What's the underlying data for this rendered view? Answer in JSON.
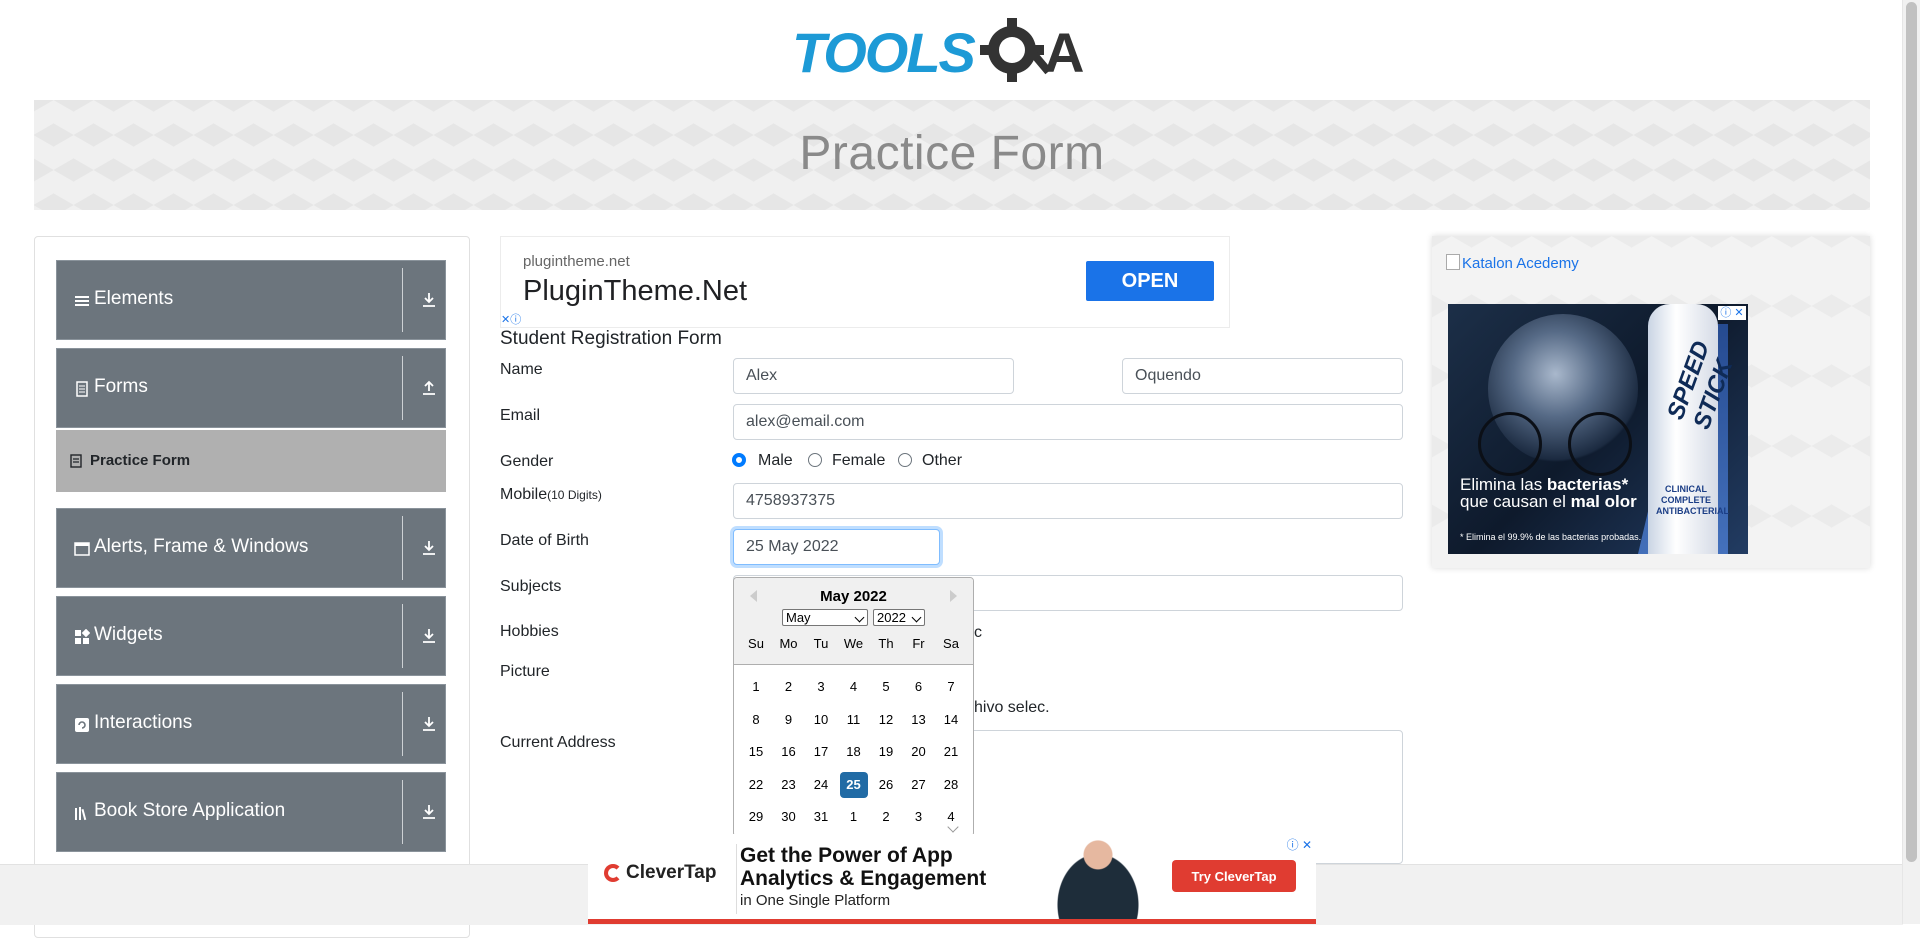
{
  "header": {
    "logo_text": "TOOLSQA"
  },
  "banner": {
    "title": "Practice Form"
  },
  "sidebar": {
    "groups": [
      {
        "label": "Elements",
        "icon": "list-icon",
        "arrow": "download-arrow-icon"
      },
      {
        "label": "Forms",
        "icon": "document-icon",
        "arrow": "upload-arrow-icon"
      },
      {
        "label": "Alerts, Frame & Windows",
        "icon": "window-icon",
        "arrow": "download-arrow-icon"
      },
      {
        "label": "Widgets",
        "icon": "widgets-icon",
        "arrow": "download-arrow-icon"
      },
      {
        "label": "Interactions",
        "icon": "interactions-icon",
        "arrow": "download-arrow-icon"
      },
      {
        "label": "Book Store Application",
        "icon": "books-icon",
        "arrow": "download-arrow-icon"
      }
    ],
    "active_item": {
      "label": "Practice Form",
      "icon": "form-icon"
    }
  },
  "ad_top": {
    "domain": "plugintheme.net",
    "headline": "PluginTheme.Net",
    "button": "OPEN"
  },
  "form": {
    "title": "Student Registration Form",
    "labels": {
      "name": "Name",
      "email": "Email",
      "gender": "Gender",
      "mobile": "Mobile",
      "mobile_hint": "(10 Digits)",
      "dob": "Date of Birth",
      "subjects": "Subjects",
      "hobbies": "Hobbies",
      "picture": "Picture",
      "address": "Current Address"
    },
    "values": {
      "first_name": "Alex",
      "last_name": "Oquendo",
      "email": "alex@email.com",
      "mobile": "4758937375",
      "dob": "25 May 2022"
    },
    "gender_options": [
      "Male",
      "Female",
      "Other"
    ],
    "gender_selected": "Male",
    "partial_hobbies_text": "c",
    "partial_file_text": "hivo selec."
  },
  "datepicker": {
    "month_title": "May 2022",
    "month_select": "May",
    "year_select": "2022",
    "day_names": [
      "Su",
      "Mo",
      "Tu",
      "We",
      "Th",
      "Fr",
      "Sa"
    ],
    "weeks": [
      [
        "1",
        "2",
        "3",
        "4",
        "5",
        "6",
        "7"
      ],
      [
        "8",
        "9",
        "10",
        "11",
        "12",
        "13",
        "14"
      ],
      [
        "15",
        "16",
        "17",
        "18",
        "19",
        "20",
        "21"
      ],
      [
        "22",
        "23",
        "24",
        "25",
        "26",
        "27",
        "28"
      ],
      [
        "29",
        "30",
        "31",
        "1",
        "2",
        "3",
        "4"
      ]
    ],
    "selected_day": "25"
  },
  "right_ad": {
    "katalon_alt": "Katalon Acedemy",
    "line1_pre": "Elimina las ",
    "line1_bold": "bacterias*",
    "line2_pre": "que causan el ",
    "line2_bold": "mal olor",
    "footnote": "* Elimina el 99.9% de las bacterias probadas.",
    "brand": "SPEED STICK",
    "can_label": "CLINICAL COMPLETE ANTIBACTERIAL"
  },
  "bottom_ad": {
    "logo": "CleverTap",
    "headline_1": "Get the Power of App",
    "headline_2": "Analytics & Engagement",
    "subline": "in One Single Platform",
    "button": "Try CleverTap"
  },
  "colors": {
    "logo_blue": "#1d9ad6",
    "logo_dark": "#333333",
    "sidebar_bg": "#6c757d",
    "active_item_bg": "#b0b0b0",
    "ad_blue": "#1a73e8",
    "selected_day": "#216ba5",
    "clevertap_red": "#e03c31"
  }
}
